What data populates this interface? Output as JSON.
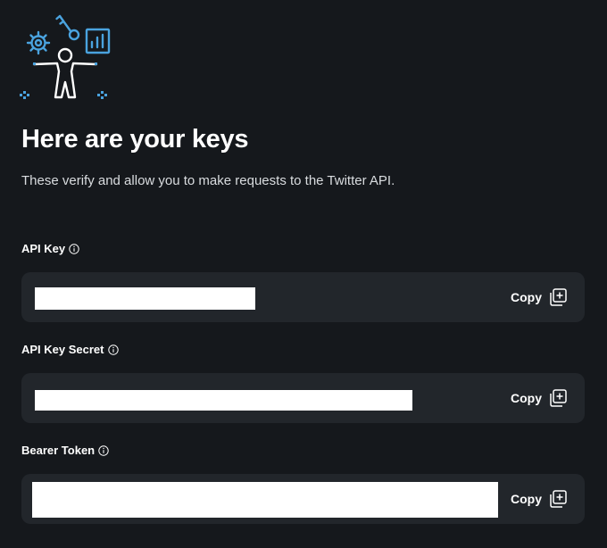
{
  "header": {
    "title": "Here are your keys",
    "subtitle": "These verify and allow you to make requests to the Twitter API."
  },
  "fields": [
    {
      "label": "API Key",
      "value_redacted": true,
      "copy_label": "Copy"
    },
    {
      "label": "API Key Secret",
      "value_redacted": true,
      "copy_label": "Copy"
    },
    {
      "label": "Bearer Token",
      "value_redacted": true,
      "copy_label": "Copy"
    }
  ],
  "colors": {
    "background": "#15181c",
    "panel": "#22262b",
    "accent": "#4aa3df",
    "text": "#ffffff",
    "muted": "#d9dcdf"
  },
  "icons": {
    "illustration": "developer-keys-illustration",
    "info": "info-icon",
    "copy": "copy-icon"
  }
}
